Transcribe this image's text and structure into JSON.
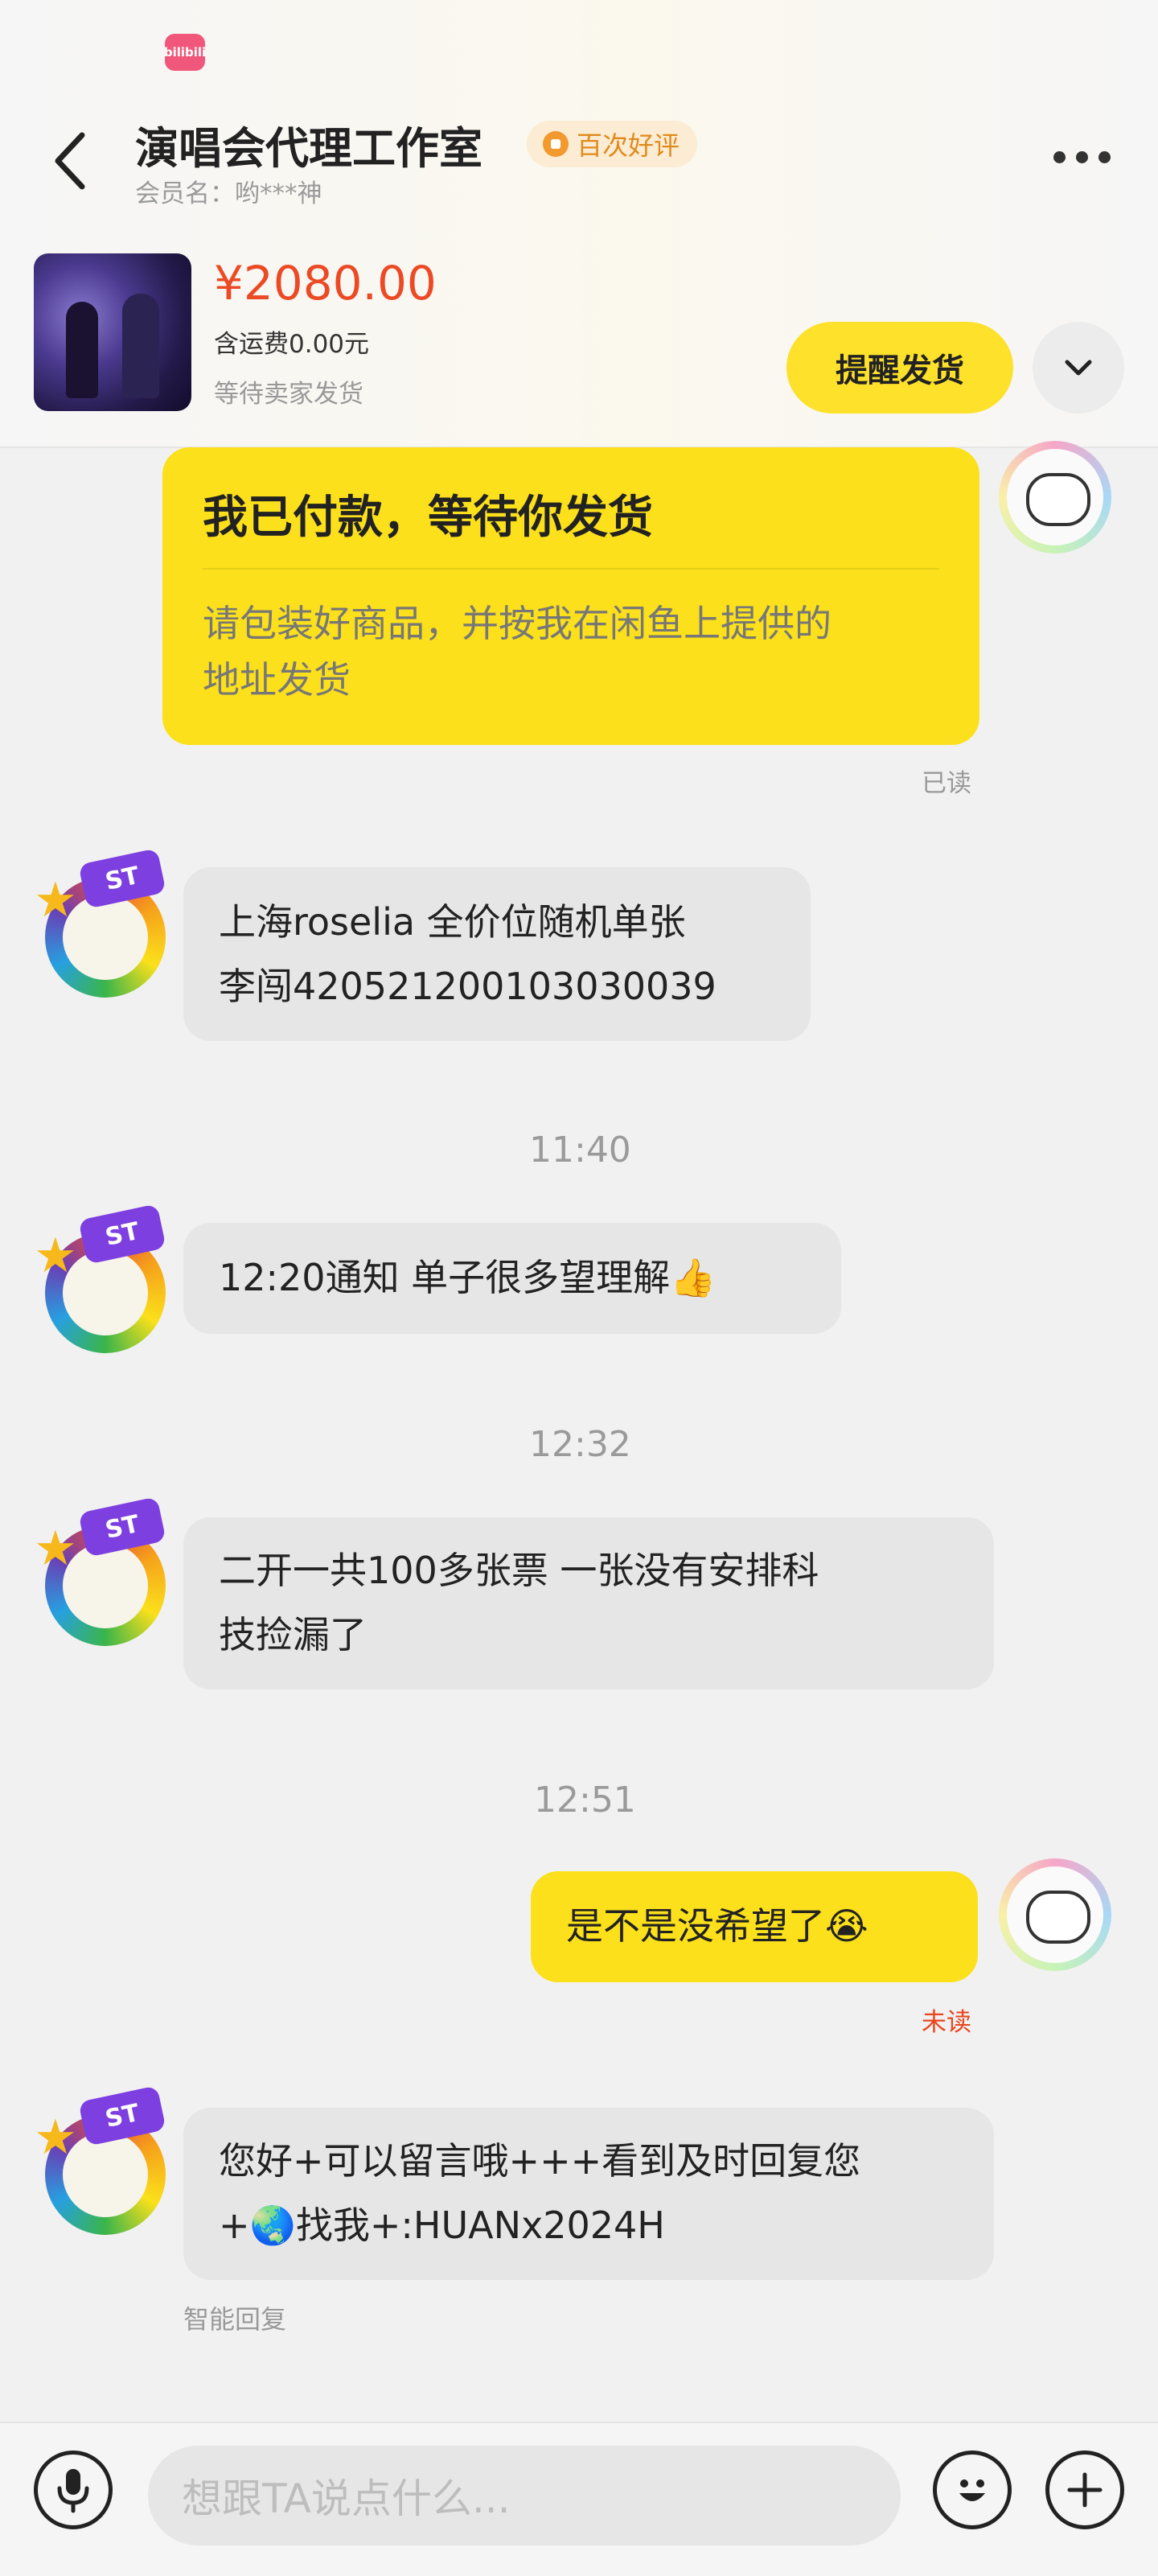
{
  "header": {
    "app_badge": "bilibili",
    "title": "演唱会代理工作室",
    "badge": "百次好评",
    "member": "会员名：哟***神"
  },
  "order": {
    "price": "¥2080.00",
    "shipping": "含运费0.00元",
    "status": "等待卖家发货",
    "remind_button": "提醒发货"
  },
  "messages": {
    "m1_title": "我已付款，等待你发货",
    "m1_body_line1": "请包装好商品，并按我在闲鱼上提供的",
    "m1_body_line2": "地址发货",
    "m1_read": "已读",
    "m2_line1": "上海roselia 全价位随机单张",
    "m2_line2": "李闯420521200103030039",
    "t1": "11:40",
    "m3": "12:20通知 单子很多望理解",
    "m3_emoji": "👍",
    "t2": "12:32",
    "m4_line1": "二开一共100多张票 一张没有安排科",
    "m4_line2": "技捡漏了",
    "t3": "12:51",
    "m5": "是不是没希望了",
    "m5_emoji": "😭",
    "m5_read": "未读",
    "m6_line1": "您好+可以留言哦+++看到及时回复您",
    "m6_line2_a": "+",
    "m6_globe": "🌏",
    "m6_line2_b": "找我+:HUANx2024H",
    "m6_tag": "智能回复",
    "avatar_flag": "ST"
  },
  "footer": {
    "placeholder": "想跟TA说点什么..."
  },
  "colors": {
    "accent_yellow": "#fbe01b",
    "price_red": "#ec4a24",
    "unread_red": "#e8461e"
  }
}
